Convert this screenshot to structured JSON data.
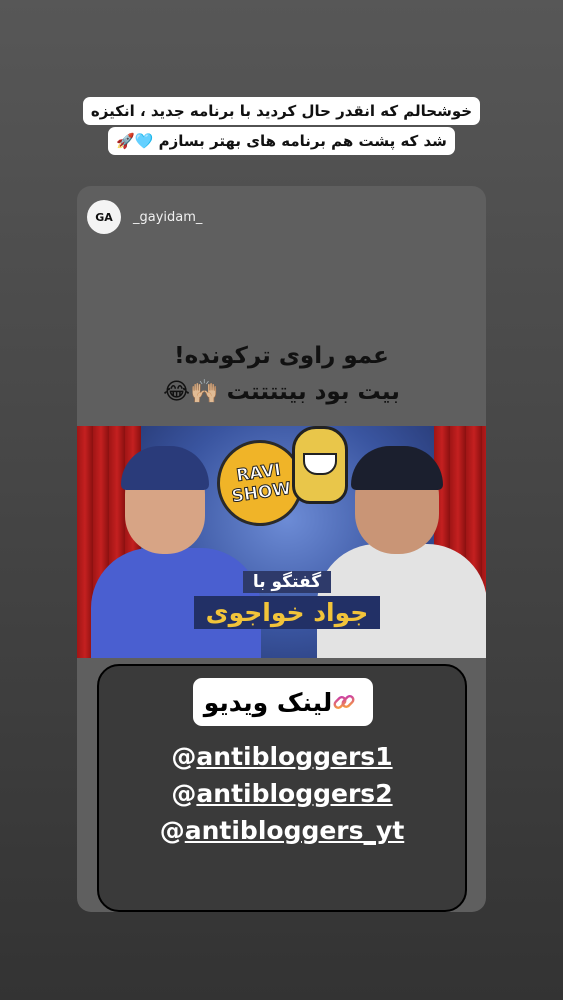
{
  "story": {
    "caption_lines": [
      "خوشحالم که انقدر حال کردید با برنامه جدید ، انکیزه",
      "شد که پشت هم برنامه های بهتر بسازم"
    ],
    "caption_emojis": "🩵🚀"
  },
  "post": {
    "avatar_initials": "GA",
    "username": "_gayidam_",
    "title_line1": "عمو راوی ترکونده!",
    "title_line2": "بیت بود بیتتتتت",
    "title_emojis": "🙌🏼😂",
    "thumbnail": {
      "logo_line1": "RAVI",
      "logo_line2": "SHOW",
      "caption_small": "گفتگو با",
      "caption_big": "جواد خواجوی"
    }
  },
  "link_sticker": {
    "label": "لینک ویدیو",
    "icon": "link-icon"
  },
  "handles": [
    {
      "prefix": "@",
      "name": "antibloggers1"
    },
    {
      "prefix": "@",
      "name": "antibloggers2"
    },
    {
      "prefix": "@",
      "name": "antibloggers_yt"
    }
  ],
  "colors": {
    "background_top": "#575757",
    "background_bottom": "#333333",
    "card": "#5f5f5f",
    "link_gradient_start": "#f9a23b",
    "link_gradient_end": "#c837ab"
  }
}
